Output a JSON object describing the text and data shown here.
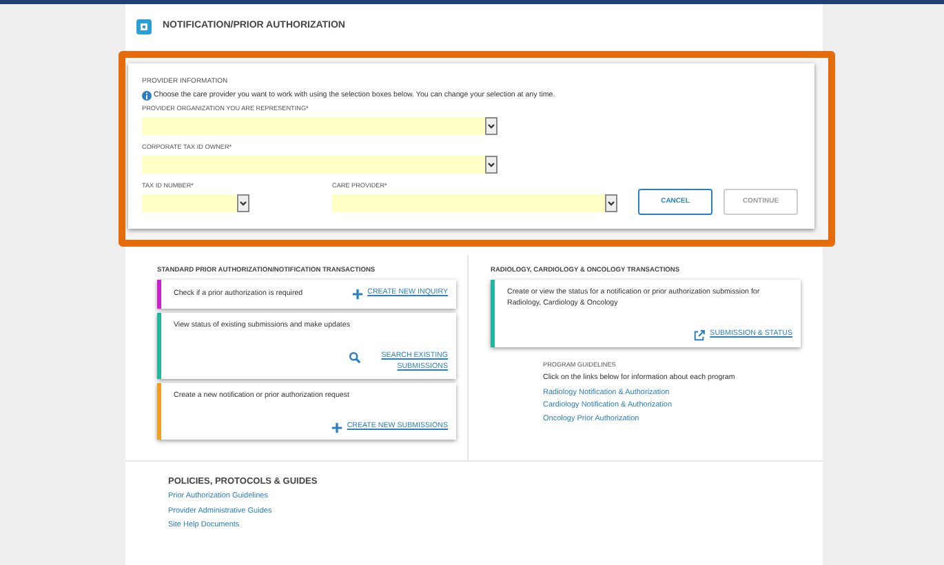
{
  "page_title": "NOTIFICATION/PRIOR AUTHORIZATION",
  "provider_information": {
    "heading": "PROVIDER INFORMATION",
    "info": "Choose the care provider you want to work with using the selection boxes below. You can change your selection at any time.",
    "fields": [
      {
        "label": "PROVIDER ORGANIZATION YOU ARE REPRESENTING*"
      },
      {
        "label": "CORPORATE TAX ID OWNER*"
      },
      {
        "label": "TAX ID NUMBER*"
      },
      {
        "label": "CARE PROVIDER*"
      }
    ],
    "buttons": [
      {
        "label": "CANCEL",
        "disabled": false
      },
      {
        "label": "CONTINUE",
        "disabled": true
      }
    ]
  },
  "standard_transactions": {
    "heading": "STANDARD PRIOR AUTHORIZATION/NOTIFICATION TRANSACTIONS",
    "cards": [
      {
        "text": "Check if a prior authorization is required",
        "link": "CREATE NEW INQUIRY",
        "color": "#cc22cc"
      },
      {
        "text": "View status of existing submissions and make updates",
        "link": "SEARCH EXISTING SUBMISSIONS",
        "color": "#22b5a0"
      },
      {
        "text": "Create a new notification or prior authorization request",
        "link": "CREATE NEW SUBMISSIONS",
        "color": "#f0a020"
      }
    ]
  },
  "specialty_transactions": {
    "heading": "RADIOLOGY, CARDIOLOGY & ONCOLOGY TRANSACTIONS",
    "cards": [
      {
        "text": "Create or view the status for a notification or prior authorization submission for Radiology, Cardiology & Oncology",
        "link": "SUBMISSION & STATUS",
        "color": "#22b5a0"
      }
    ],
    "guidelines": {
      "heading": "PROGRAM GUIDELINES",
      "intro": "Click on the links below for information about each program",
      "links": [
        "Radiology Notification & Authorization",
        "Cardiology Notification & Authorization",
        "Oncology Prior Authorization"
      ]
    }
  },
  "policies": {
    "heading": "POLICIES, PROTOCOLS & GUIDES",
    "links": [
      "Prior Authorization Guidelines",
      "Provider Administrative Guides",
      "Site Help Documents"
    ]
  }
}
